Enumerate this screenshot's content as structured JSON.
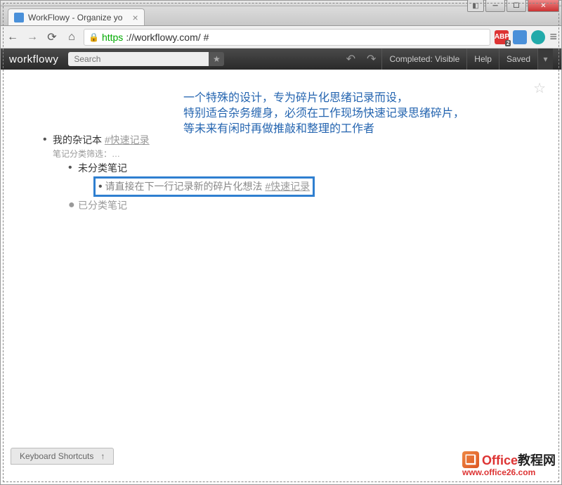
{
  "window": {
    "tab_title": "WorkFlowy - Organize yo",
    "url_secure": "https",
    "url_host": "://workflowy.com/",
    "url_hash": "#"
  },
  "toolbar": {
    "logo": "workflowy",
    "search_placeholder": "Search",
    "completed_label": "Completed: Visible",
    "help_label": "Help",
    "saved_label": "Saved"
  },
  "annotation": {
    "line1": "一个特殊的设计，专为碎片化思绪记录而设，",
    "line2": "特别适合杂务缠身，必须在工作现场快速记录思绪碎片，",
    "line3": "等未来有闲时再做推敲和整理的工作者"
  },
  "outline": {
    "root_text": "我的杂记本 ",
    "root_tag": "#快速记录",
    "root_note": "笔记分类筛选：…",
    "child1": "未分类笔记",
    "child1_sub_text": "请直接在下一行记录新的碎片化想法 ",
    "child1_sub_tag": "#快速记录",
    "child2": "已分类笔记"
  },
  "footer": {
    "kbd_label": "Keyboard Shortcuts"
  },
  "watermark": {
    "title_red": "Office",
    "title_black": "教程网",
    "url": "www.office26.com"
  },
  "ext": {
    "abp": "ABP",
    "abp_badge": "2"
  }
}
